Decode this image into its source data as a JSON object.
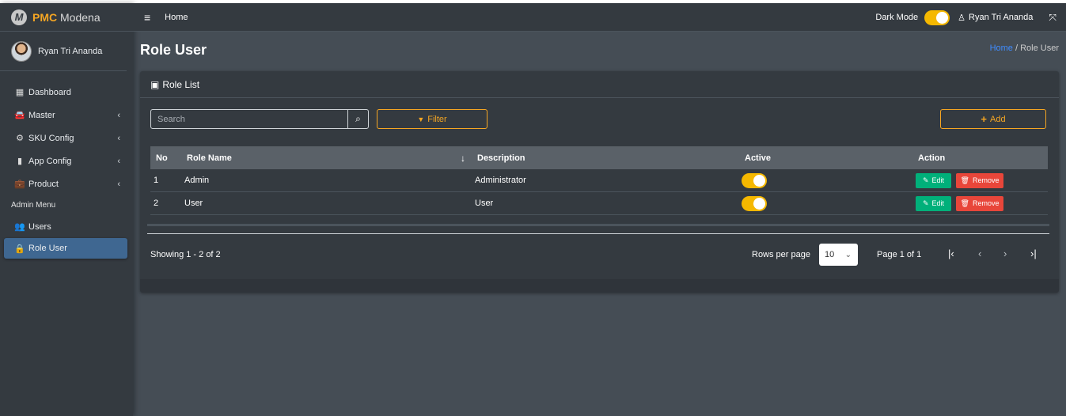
{
  "brand": {
    "bold": "PMC",
    "rest": " Modena",
    "logo": "M"
  },
  "sidebar": {
    "user_name": "Ryan Tri Ananda",
    "items": [
      {
        "label": "Dashboard",
        "icon": "grid-icon",
        "glyph": "▦"
      },
      {
        "label": "Master",
        "icon": "car-icon",
        "glyph": "🚘"
      },
      {
        "label": "SKU Config",
        "icon": "gear-icon",
        "glyph": "⚙"
      },
      {
        "label": "App Config",
        "icon": "mobile-icon",
        "glyph": "▮"
      },
      {
        "label": "Product",
        "icon": "briefcase-icon",
        "glyph": "💼"
      }
    ],
    "section_header": "Admin Menu",
    "admin_items": [
      {
        "label": "Users",
        "icon": "users-icon",
        "glyph": "👥"
      },
      {
        "label": "Role User",
        "icon": "lock-icon",
        "glyph": "🔒"
      }
    ],
    "chevron": "‹"
  },
  "topbar": {
    "hamburger": "≡",
    "home": "Home",
    "dark_mode_label": "Dark Mode",
    "user_icon": "♙",
    "user_name": "Ryan Tri Ananda",
    "expand_icon": "⤧"
  },
  "page": {
    "title": "Role User",
    "breadcrumb_home": "Home",
    "breadcrumb_sep": " / ",
    "breadcrumb_current": "Role User"
  },
  "card": {
    "header_icon": "▣",
    "header": "Role List",
    "search_placeholder": "Search",
    "search_icon": "⌕",
    "filter_icon": "▼",
    "filter_label": "Filter",
    "add_icon": "+",
    "add_label": "Add"
  },
  "table": {
    "columns": {
      "no": "No",
      "name": "Role Name",
      "sort_icon": "↓",
      "desc": "Description",
      "active": "Active",
      "action": "Action"
    },
    "rows": [
      {
        "no": "1",
        "name": "Admin",
        "desc": "Administrator",
        "active": true
      },
      {
        "no": "2",
        "name": "User",
        "desc": "User",
        "active": true
      }
    ],
    "edit_icon": "✎",
    "edit_label": "Edit",
    "remove_icon": "🗑",
    "remove_label": "Remove"
  },
  "pagination": {
    "showing": "Showing 1 - 2 of 2",
    "rows_per_page_label": "Rows per page",
    "rows_per_page": "10",
    "select_chevron": "⌄",
    "page_info": "Page 1 of 1",
    "first": "|‹",
    "prev": "‹",
    "next": "›",
    "last": "›|"
  },
  "colors": {
    "accent": "#f5a623",
    "active_nav": "#3f6791",
    "edit": "#00b07a",
    "remove": "#e8463a",
    "toggle": "#f5b800"
  }
}
